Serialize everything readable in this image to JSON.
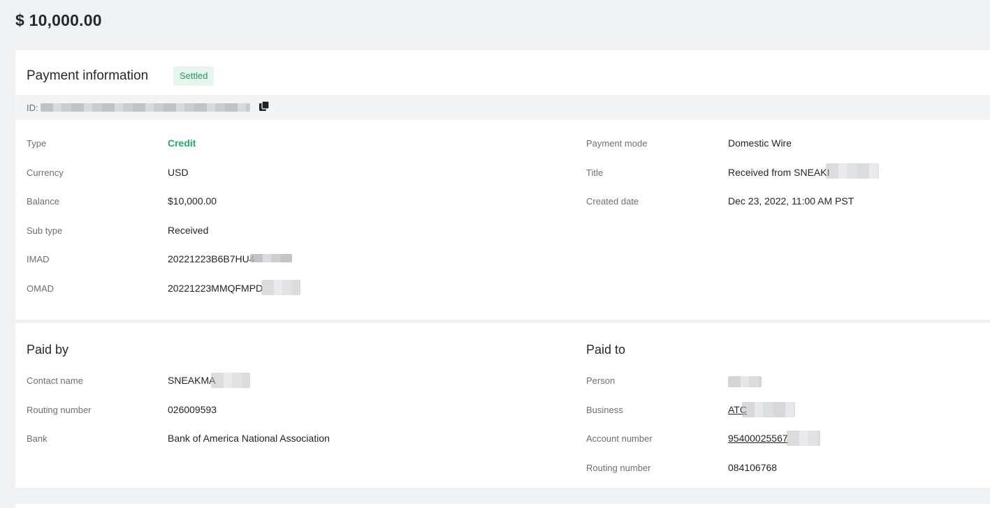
{
  "amount": "$ 10,000.00",
  "payment_info": {
    "title": "Payment information",
    "status": "Settled",
    "id_label": "ID:",
    "left": [
      {
        "label": "Type",
        "value": "Credit"
      },
      {
        "label": "Currency",
        "value": "USD"
      },
      {
        "label": "Balance",
        "value": "$10,000.00"
      },
      {
        "label": "Sub type",
        "value": "Received"
      },
      {
        "label": "IMAD",
        "value": "20221223B6B7HU4"
      },
      {
        "label": "OMAD",
        "value": "20221223MMQFMPD"
      }
    ],
    "right": [
      {
        "label": "Payment mode",
        "value": "Domestic Wire"
      },
      {
        "label": "Title",
        "value": "Received from SNEAKI"
      },
      {
        "label": "Created date",
        "value": "Dec 23, 2022, 11:00 AM PST"
      }
    ]
  },
  "paid_by": {
    "title": "Paid by",
    "rows": [
      {
        "label": "Contact name",
        "value": "SNEAKMA"
      },
      {
        "label": "Routing number",
        "value": "026009593"
      },
      {
        "label": "Bank",
        "value": "Bank of America National Association"
      }
    ]
  },
  "paid_to": {
    "title": "Paid to",
    "rows": [
      {
        "label": "Person",
        "value": ""
      },
      {
        "label": "Business",
        "value": "ATC"
      },
      {
        "label": "Account number",
        "value": "95400025567"
      },
      {
        "label": "Routing number",
        "value": "084106768"
      }
    ]
  },
  "colors": {
    "accent_green": "#1fae66",
    "badge_bg": "#e6f6ee"
  },
  "icons": {
    "copy": "copy-icon"
  }
}
